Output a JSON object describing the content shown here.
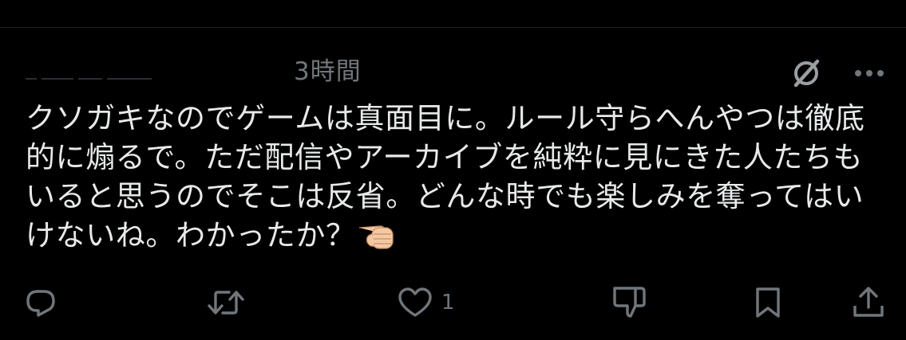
{
  "post": {
    "timestamp": "3時間",
    "text": "クソガキなのでゲームは真面目に。ルール守らへんやつは徹底的に煽るで。ただ配信やアーカイブを純粋に見にきた人たちもいると思うのでそこは反省。どんな時でも楽しみを奪ってはいけないね。わかったか？",
    "emoji": "pointing-hand-emoji"
  },
  "actions": {
    "reply_icon": "reply-icon",
    "repost_icon": "repost-icon",
    "like_icon": "heart-icon",
    "like_count": "1",
    "dislike_icon": "thumbs-down-icon",
    "bookmark_icon": "bookmark-icon",
    "share_icon": "share-icon"
  },
  "header": {
    "grok_icon": "grok-icon",
    "more_icon": "more-options-icon"
  },
  "colors": {
    "background": "#000000",
    "text": "#e7e9ea",
    "secondary": "#71767b"
  }
}
